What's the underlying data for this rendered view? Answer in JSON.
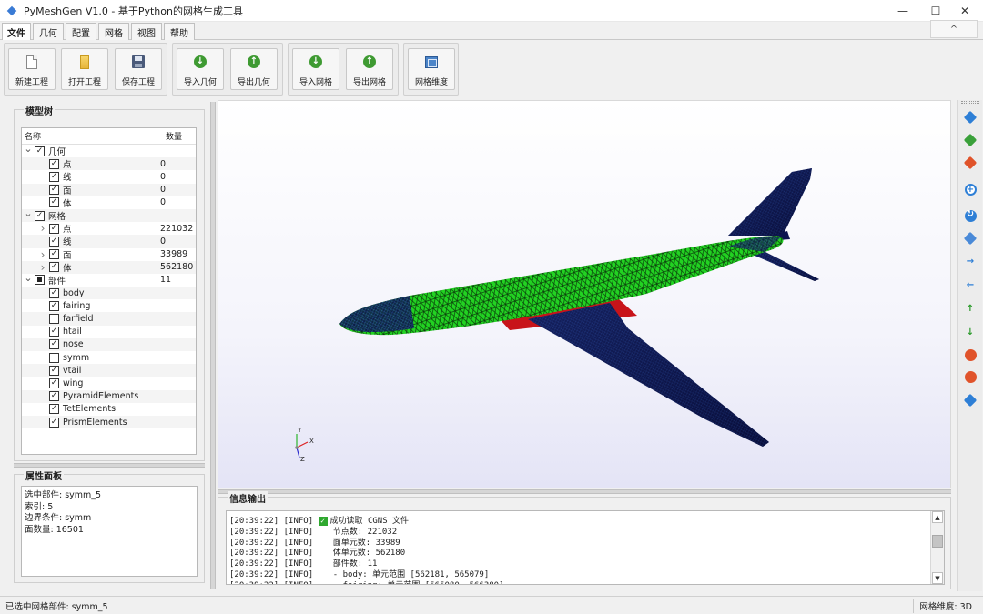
{
  "window": {
    "title": "PyMeshGen V1.0 - 基于Python的网格生成工具",
    "minimize": "—",
    "maximize": "☐",
    "close": "✕"
  },
  "menu": {
    "tabs": [
      "文件",
      "几何",
      "配置",
      "网格",
      "视图",
      "帮助"
    ],
    "active": "文件",
    "collapse": "^"
  },
  "ribbon": {
    "file": [
      "新建工程",
      "打开工程",
      "保存工程"
    ],
    "geometry": [
      "导入几何",
      "导出几何"
    ],
    "mesh": [
      "导入网格",
      "导出网格"
    ],
    "dimension": [
      "网格维度"
    ]
  },
  "model_tree": {
    "title": "模型树",
    "col_name": "名称",
    "col_count": "数量",
    "rows": [
      {
        "label": "几何",
        "count": "",
        "level": 0,
        "check": "checked",
        "arrow": "down"
      },
      {
        "label": "点",
        "count": "0",
        "level": 1,
        "check": "checked",
        "arrow": ""
      },
      {
        "label": "线",
        "count": "0",
        "level": 1,
        "check": "checked",
        "arrow": ""
      },
      {
        "label": "面",
        "count": "0",
        "level": 1,
        "check": "checked",
        "arrow": ""
      },
      {
        "label": "体",
        "count": "0",
        "level": 1,
        "check": "checked",
        "arrow": ""
      },
      {
        "label": "网格",
        "count": "",
        "level": 0,
        "check": "checked",
        "arrow": "down"
      },
      {
        "label": "点",
        "count": "221032",
        "level": 1,
        "check": "checked",
        "arrow": "right"
      },
      {
        "label": "线",
        "count": "0",
        "level": 1,
        "check": "checked",
        "arrow": ""
      },
      {
        "label": "面",
        "count": "33989",
        "level": 1,
        "check": "checked",
        "arrow": "right"
      },
      {
        "label": "体",
        "count": "562180",
        "level": 1,
        "check": "checked",
        "arrow": "right"
      },
      {
        "label": "部件",
        "count": "11",
        "level": 0,
        "check": "partial",
        "arrow": "down"
      },
      {
        "label": "body",
        "count": "",
        "level": 1,
        "check": "checked",
        "arrow": ""
      },
      {
        "label": "fairing",
        "count": "",
        "level": 1,
        "check": "checked",
        "arrow": ""
      },
      {
        "label": "farfield",
        "count": "",
        "level": 1,
        "check": "unchecked",
        "arrow": ""
      },
      {
        "label": "htail",
        "count": "",
        "level": 1,
        "check": "checked",
        "arrow": ""
      },
      {
        "label": "nose",
        "count": "",
        "level": 1,
        "check": "checked",
        "arrow": ""
      },
      {
        "label": "symm",
        "count": "",
        "level": 1,
        "check": "unchecked",
        "arrow": ""
      },
      {
        "label": "vtail",
        "count": "",
        "level": 1,
        "check": "checked",
        "arrow": ""
      },
      {
        "label": "wing",
        "count": "",
        "level": 1,
        "check": "checked",
        "arrow": ""
      },
      {
        "label": "PyramidElements",
        "count": "",
        "level": 1,
        "check": "checked",
        "arrow": ""
      },
      {
        "label": "TetElements",
        "count": "",
        "level": 1,
        "check": "checked",
        "arrow": ""
      },
      {
        "label": "PrismElements",
        "count": "",
        "level": 1,
        "check": "checked",
        "arrow": ""
      }
    ]
  },
  "properties": {
    "title": "属性面板",
    "lines": [
      "选中部件: symm_5",
      "索引: 5",
      "边界条件: symm",
      "面数量: 16501"
    ]
  },
  "log": {
    "title": "信息输出",
    "lines": [
      "[20:39:22] [INFO]  成功读取 CGNS 文件",
      "[20:39:22] [INFO]    节点数: 221032",
      "[20:39:22] [INFO]    面单元数: 33989",
      "[20:39:22] [INFO]    体单元数: 562180",
      "[20:39:22] [INFO]    部件数: 11",
      "[20:39:22] [INFO]    - body: 单元范围 [562181, 565079]",
      "[20:39:22] [INFO]    - fairing: 单元范围 [565080, 566380]"
    ]
  },
  "axes": {
    "y": "Y",
    "x": "X",
    "z": "Z"
  },
  "right_toolbar": [
    "view-front-icon",
    "view-iso-icon",
    "view-side-icon",
    "zoom-fit-icon",
    "rotate-icon",
    "surface-icon",
    "x-plus-icon",
    "x-minus-icon",
    "y-plus-icon",
    "y-minus-icon",
    "z-plus-icon",
    "z-minus-icon",
    "iso-view-icon"
  ],
  "status": {
    "left": "已选中网格部件: symm_5",
    "right": "网格维度: 3D"
  },
  "colors": {
    "mesh_green": "#1ecb1e",
    "wing_navy": "#0a0f3a",
    "accent": "#3a7bd5"
  }
}
